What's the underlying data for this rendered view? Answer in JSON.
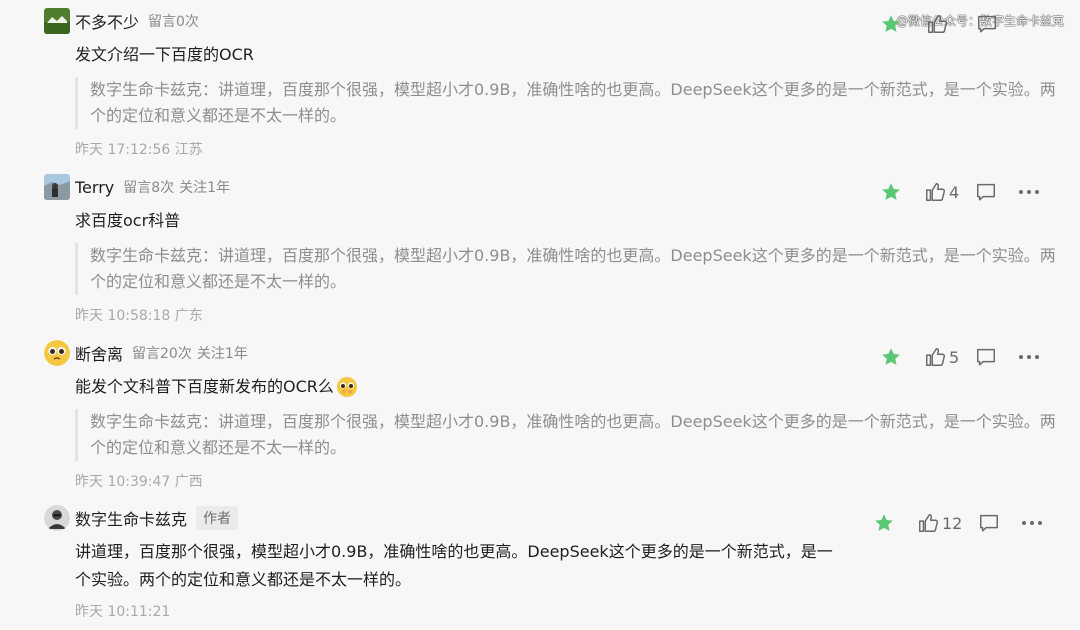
{
  "watermark": "@微信公众号：数字生命卡兹克",
  "comments": [
    {
      "nickname": "不多不少",
      "meta1": "留言0次",
      "meta2": "",
      "text": "发文介绍一下百度的OCR",
      "reply": "数字生命卡兹克：讲道理，百度那个很强，模型超小才0.9B，准确性啥的也更高。DeepSeek这个更多的是一个新范式，是一个实验。两个的定位和意义都还是不太一样的。",
      "time": "昨天 17:12:56 江苏",
      "likes": ""
    },
    {
      "nickname": "Terry",
      "meta1": "留言8次",
      "meta2": "关注1年",
      "text": "求百度ocr科普",
      "reply": "数字生命卡兹克：讲道理，百度那个很强，模型超小才0.9B，准确性啥的也更高。DeepSeek这个更多的是一个新范式，是一个实验。两个的定位和意义都还是不太一样的。",
      "time": "昨天 10:58:18 广东",
      "likes": "4"
    },
    {
      "nickname": "断舍离",
      "meta1": "留言20次",
      "meta2": "关注1年",
      "text": "能发个文科普下百度新发布的OCR么",
      "reply": "数字生命卡兹克：讲道理，百度那个很强，模型超小才0.9B，准确性啥的也更高。DeepSeek这个更多的是一个新范式，是一个实验。两个的定位和意义都还是不太一样的。",
      "time": "昨天 10:39:47 广西",
      "likes": "5"
    },
    {
      "nickname": "数字生命卡兹克",
      "badge": "作者",
      "text": "讲道理，百度那个很强，模型超小才0.9B，准确性啥的也更高。DeepSeek这个更多的是一个新范式，是一个实验。两个的定位和意义都还是不太一样的。",
      "time": "昨天 10:11:21",
      "likes": "12"
    }
  ],
  "colors": {
    "star": "#5bc772",
    "icon": "#6a6a6a",
    "background": "#f7f7f7"
  },
  "icons": [
    "avatar",
    "star-icon",
    "thumb-up-icon",
    "comment-icon",
    "more-icon",
    "pleading-emoji-icon"
  ]
}
